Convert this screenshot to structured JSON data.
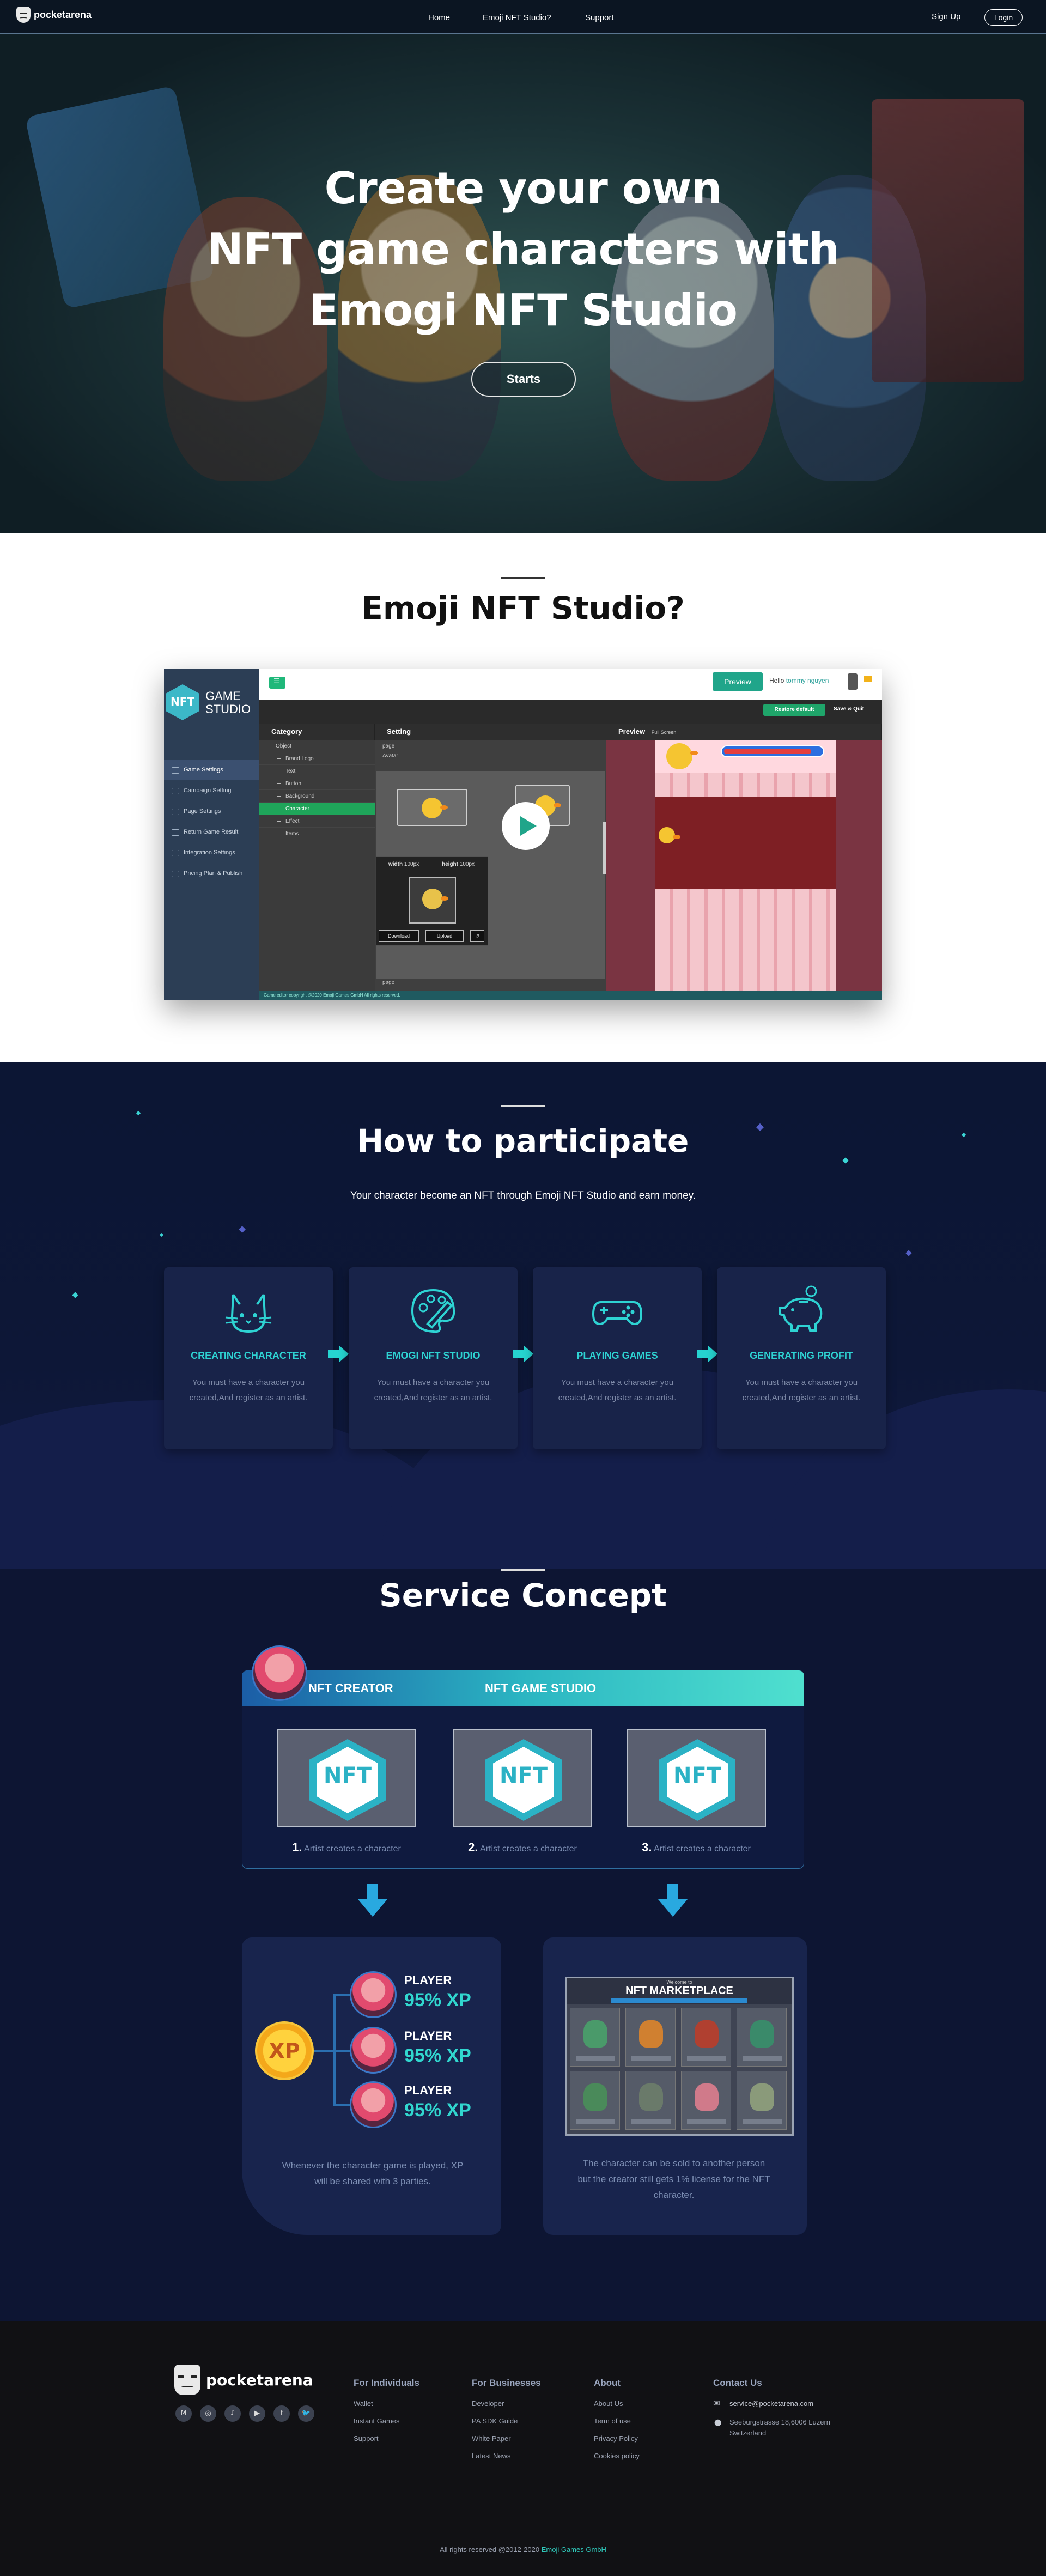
{
  "nav": {
    "brand": "pocketarena",
    "links": [
      "Home",
      "Emoji NFT Studio?",
      "Support"
    ],
    "signup": "Sign Up",
    "login": "Login"
  },
  "hero": {
    "title_lines": [
      "Create your own",
      "NFT game characters with",
      "Emogi NFT Studio"
    ],
    "cta": "Starts"
  },
  "studio": {
    "title": "Emoji NFT Studio?",
    "app": {
      "logo_top": "GAME",
      "logo_bottom": "STUDIO",
      "menu": [
        "Game Settings",
        "Campaign Setting",
        "Page Settings",
        "Return Game Result",
        "Integration Settings",
        "Pricing Plan & Publish"
      ],
      "preview_btn": "Preview",
      "hello_prefix": "Hello",
      "hello_user": "tommy nguyen",
      "restore_btn": "Restore default",
      "save_btn": "Save & Quit",
      "panels": {
        "category": "Category",
        "setting": "Setting",
        "preview": "Preview",
        "full": "Full Screen"
      },
      "category_items": [
        "Object",
        "Brand Logo",
        "Text",
        "Button",
        "Background",
        "Character",
        "Effect",
        "Items"
      ],
      "setting_labels": [
        "page",
        "Avatar",
        "page"
      ],
      "popup": {
        "width_label": "width",
        "width_val": "100px",
        "height_label": "height",
        "height_val": "100px",
        "download": "Download",
        "upload": "Upload"
      },
      "footer": "Game editor copyright @2020 Emoji Games GmbH All rights reserved."
    }
  },
  "participate": {
    "title": "How to participate",
    "subtitle": "Your character  become an NFT through Emoji NFT Studio and earn money.",
    "cards": [
      {
        "icon": "cat-icon",
        "title": "CREATING CHARACTER",
        "text": "You must have a character you created,And register as an artist."
      },
      {
        "icon": "palette-icon",
        "title": "EMOGI NFT STUDIO",
        "text": "You must have a character you created,And register as an artist."
      },
      {
        "icon": "gamepad-icon",
        "title": "PLAYING GAMES",
        "text": "You must have a character you created,And register as an artist."
      },
      {
        "icon": "piggy-bank-icon",
        "title": "GENERATING PROFIT",
        "text": "You must have a character you created,And register as an artist."
      }
    ]
  },
  "service": {
    "title": "Service Concept",
    "head_left": "NFT CREATOR",
    "head_right": "NFT GAME STUDIO",
    "nft_text": "NFT",
    "steps": [
      {
        "num": "1.",
        "text": "Artist creates a character"
      },
      {
        "num": "2.",
        "text": "Artist creates a character"
      },
      {
        "num": "3.",
        "text": "Artist creates a character"
      }
    ],
    "xp_label": "XP",
    "players": [
      {
        "name": "PLAYER",
        "value": "95% XP"
      },
      {
        "name": "PLAYER",
        "value": "95% XP"
      },
      {
        "name": "PLAYER",
        "value": "95% XP"
      }
    ],
    "left_caption": "Whenever the character game is played, XP will be shared with 3 parties.",
    "market_sub": "Welcome to",
    "market_title": "NFT MARKETPLACE",
    "right_caption": "The character can be sold to another person but the creator still gets 1% license for the NFT character."
  },
  "footer": {
    "brand": "pocketarena",
    "socials": [
      "M",
      "◎",
      "♪",
      "▶",
      "f",
      "🐦"
    ],
    "cols": [
      {
        "title": "For Individuals",
        "items": [
          "Wallet",
          "Instant Games",
          "Support"
        ]
      },
      {
        "title": "For Businesses",
        "items": [
          "Developer",
          "PA SDK Guide",
          "White Paper",
          "Latest News"
        ]
      },
      {
        "title": "About",
        "items": [
          "About Us",
          "Term of use",
          "Privacy Policy",
          "Cookies policy"
        ]
      }
    ],
    "contact_title": "Contact Us",
    "email": "service@pocketarena.com",
    "address": "Seeburgstrasse 18,6006 Luzern Switzerland",
    "copyright_prefix": "All rights reserved @2012-2020",
    "copyright_company": "Emoji Games GmbH"
  }
}
